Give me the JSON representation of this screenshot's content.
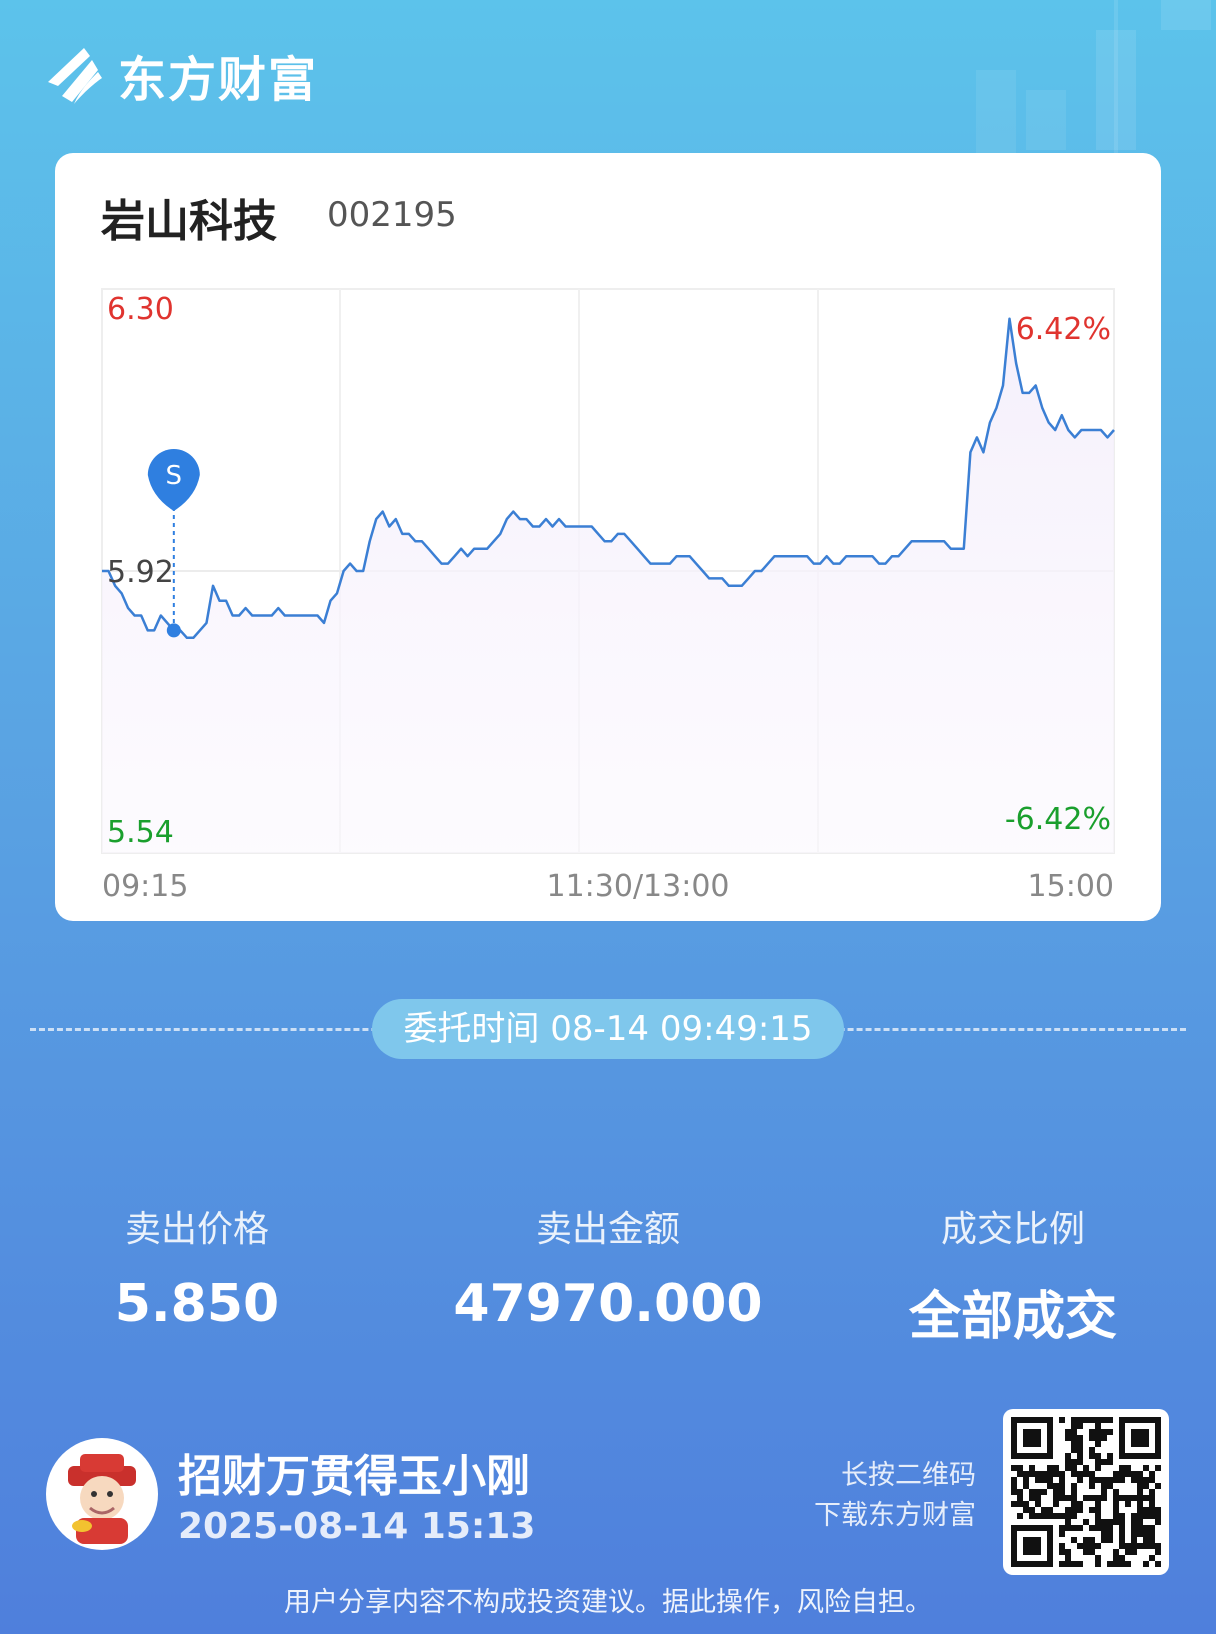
{
  "brand": {
    "name": "东方财富"
  },
  "stock": {
    "name": "岩山科技",
    "code": "002195"
  },
  "chart": {
    "max_price": "6.30",
    "prev_close": "5.92",
    "min_price": "5.54",
    "max_pct": "6.42%",
    "min_pct": "-6.42%",
    "time_start": "09:15",
    "time_mid": "11:30/13:00",
    "time_end": "15:00",
    "marker_label": "S"
  },
  "chart_data": {
    "type": "line",
    "y_range": [
      5.54,
      6.3
    ],
    "prev_close": 5.92,
    "x_labels": [
      "09:15",
      "11:30/13:00",
      "15:00"
    ],
    "series": [
      {
        "values": [
          5.92,
          5.92,
          5.9,
          5.89,
          5.87,
          5.86,
          5.86,
          5.84,
          5.84,
          5.86,
          5.85,
          5.84,
          5.84,
          5.83,
          5.83,
          5.84,
          5.85,
          5.9,
          5.88,
          5.88,
          5.86,
          5.86,
          5.87,
          5.86,
          5.86,
          5.86,
          5.86,
          5.87,
          5.86,
          5.86,
          5.86,
          5.86,
          5.86,
          5.86,
          5.85,
          5.88,
          5.89,
          5.92,
          5.93,
          5.92,
          5.92,
          5.96,
          5.99,
          6.0,
          5.98,
          5.99,
          5.97,
          5.97,
          5.96,
          5.96,
          5.95,
          5.94,
          5.93,
          5.93,
          5.94,
          5.95,
          5.94,
          5.95,
          5.95,
          5.95,
          5.96,
          5.97,
          5.99,
          6.0,
          5.99,
          5.99,
          5.98,
          5.98,
          5.99,
          5.98,
          5.99,
          5.98,
          5.98,
          5.98,
          5.98,
          5.98,
          5.97,
          5.96,
          5.96,
          5.97,
          5.97,
          5.96,
          5.95,
          5.94,
          5.93,
          5.93,
          5.93,
          5.93,
          5.94,
          5.94,
          5.94,
          5.93,
          5.92,
          5.91,
          5.91,
          5.91,
          5.9,
          5.9,
          5.9,
          5.91,
          5.92,
          5.92,
          5.93,
          5.94,
          5.94,
          5.94,
          5.94,
          5.94,
          5.94,
          5.93,
          5.93,
          5.94,
          5.93,
          5.93,
          5.94,
          5.94,
          5.94,
          5.94,
          5.94,
          5.93,
          5.93,
          5.94,
          5.94,
          5.95,
          5.96,
          5.96,
          5.96,
          5.96,
          5.96,
          5.96,
          5.95,
          5.95,
          5.95,
          6.08,
          6.1,
          6.08,
          6.12,
          6.14,
          6.17,
          6.26,
          6.2,
          6.16,
          6.16,
          6.17,
          6.14,
          6.12,
          6.11,
          6.13,
          6.11,
          6.1,
          6.11,
          6.11,
          6.11,
          6.11,
          6.1,
          6.11
        ],
        "marker": {
          "label": "S",
          "index": 11,
          "value": 5.84
        }
      }
    ]
  },
  "order": {
    "label": "委托时间",
    "datetime": "08-14 09:49:15"
  },
  "stats": [
    {
      "label": "卖出价格",
      "value": "5.850"
    },
    {
      "label": "卖出金额",
      "value": "47970.000"
    },
    {
      "label": "成交比例",
      "value": "全部成交"
    }
  ],
  "user": {
    "name": "招财万贯得玉小刚",
    "date": "2025-08-14 15:13"
  },
  "qr": {
    "line1": "长按二维码",
    "line2": "下载东方财富"
  },
  "disclaimer": "用户分享内容不构成投资建议。据此操作，风险自担。",
  "colors": {
    "up": "#e0342f",
    "down": "#1a9f2d",
    "line": "#3b7fd4",
    "card_bg": "#ffffff"
  }
}
